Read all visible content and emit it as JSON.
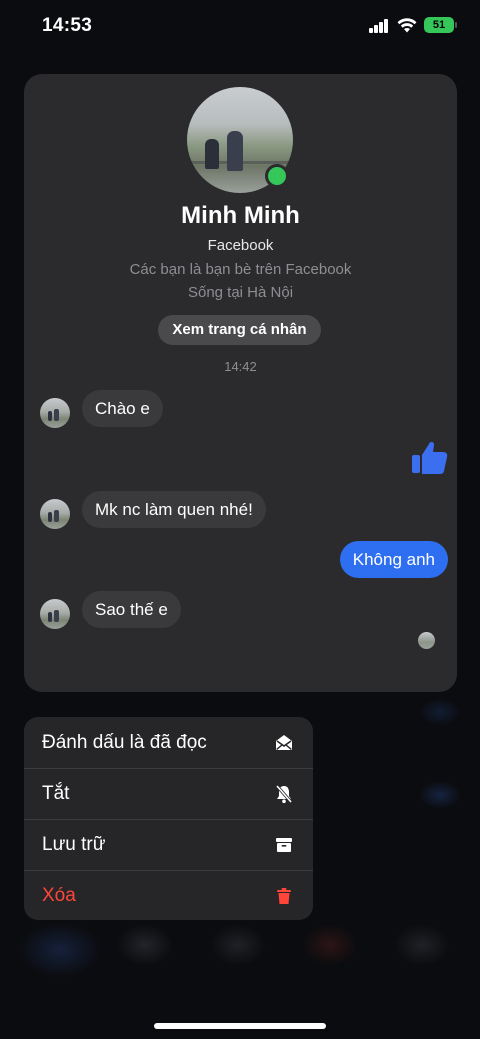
{
  "status_bar": {
    "time": "14:53",
    "battery": "51"
  },
  "profile": {
    "name": "Minh Minh",
    "platform": "Facebook",
    "relation": "Các bạn là bạn bè trên Facebook",
    "location": "Sống tại Hà Nội",
    "view_profile_label": "Xem trang cá nhân"
  },
  "chat": {
    "timestamp": "14:42",
    "messages": [
      {
        "from": "them",
        "text": "Chào e"
      },
      {
        "from": "me",
        "type": "like",
        "icon": "thumbs-up-icon"
      },
      {
        "from": "them",
        "text": "Mk nc làm quen nhé!"
      },
      {
        "from": "me",
        "text": "Không anh"
      },
      {
        "from": "them",
        "text": "Sao thế e"
      }
    ]
  },
  "menu": {
    "items": [
      {
        "label": "Đánh dấu là đã đọc",
        "icon": "envelope-open-icon"
      },
      {
        "label": "Tắt",
        "icon": "bell-slash-icon"
      },
      {
        "label": "Lưu trữ",
        "icon": "archive-box-icon"
      },
      {
        "label": "Xóa",
        "icon": "trash-icon",
        "color": "#ff453a"
      }
    ]
  },
  "colors": {
    "accent": "#2e6ff2",
    "online": "#35c759",
    "danger": "#ff453a",
    "card": "#2b2b2d"
  }
}
